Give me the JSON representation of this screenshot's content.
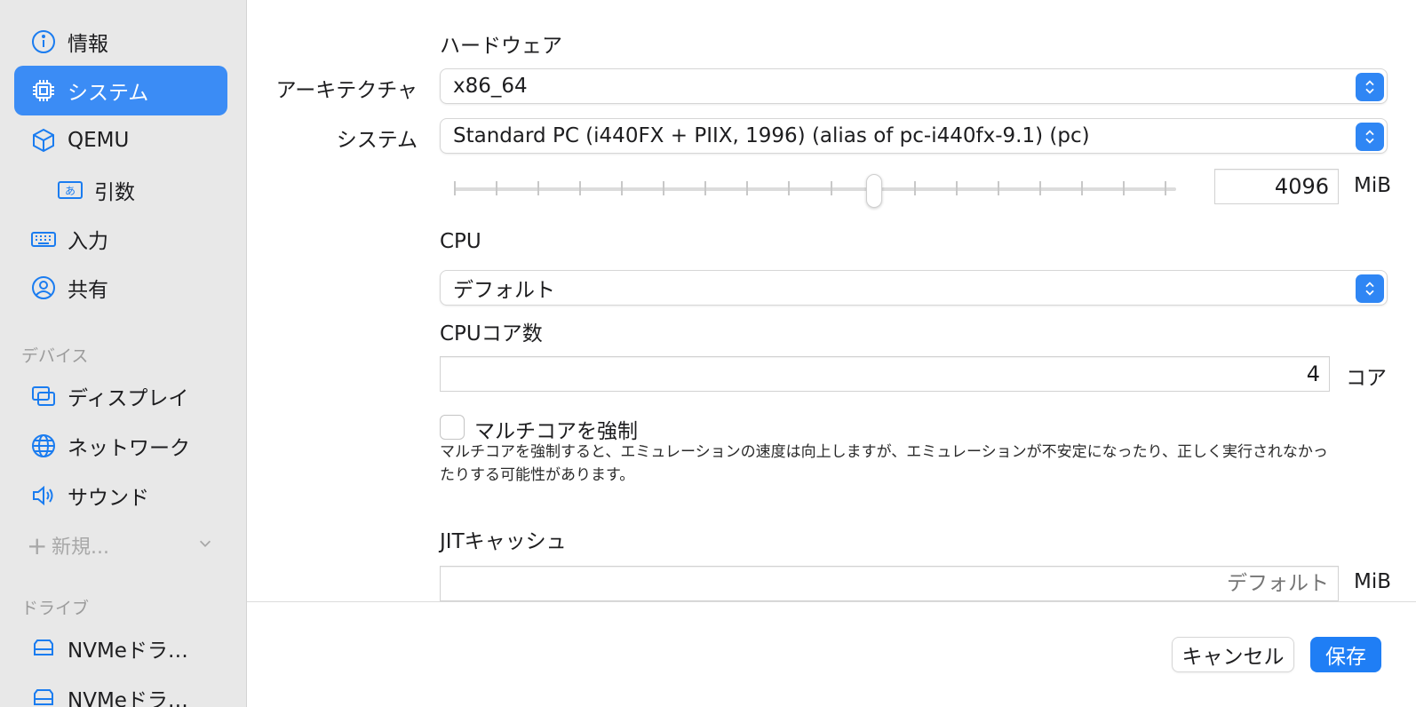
{
  "sidebar": {
    "items": [
      {
        "label": "情報",
        "icon": "info-icon"
      },
      {
        "label": "システム",
        "icon": "cpu-chip-icon",
        "active": true
      },
      {
        "label": "QEMU",
        "icon": "cube-icon"
      },
      {
        "label": "引数",
        "icon": "text-input-icon"
      },
      {
        "label": "入力",
        "icon": "keyboard-icon"
      },
      {
        "label": "共有",
        "icon": "person-circle-icon"
      }
    ],
    "devices_header": "デバイス",
    "devices": [
      {
        "label": "ディスプレイ",
        "icon": "display-icon"
      },
      {
        "label": "ネットワーク",
        "icon": "globe-icon"
      },
      {
        "label": "サウンド",
        "icon": "speaker-icon"
      }
    ],
    "new_label": "新規...",
    "drives_header": "ドライブ",
    "drives": [
      {
        "label": "NVMeドラ…",
        "icon": "drive-icon"
      },
      {
        "label": "NVMeドラ…",
        "icon": "drive-icon"
      }
    ]
  },
  "hardware": {
    "heading": "ハードウェア",
    "architecture_label": "アーキテクチャ",
    "architecture_value": "x86_64",
    "system_label": "システム",
    "system_value": "Standard PC (i440FX + PIIX, 1996) (alias of pc-i440fx-9.1) (pc)",
    "memory_value": "4096",
    "memory_unit": "MiB",
    "memory_slider_fraction": 0.59
  },
  "cpu": {
    "heading": "CPU",
    "value": "デフォルト",
    "cores_heading": "CPUコア数",
    "cores_value": "4",
    "cores_unit": "コア",
    "force_multicore_label": "マルチコアを強制",
    "force_multicore_checked": false,
    "force_multicore_description": "マルチコアを強制すると、エミュレーションの速度は向上しますが、エミュレーションが不安定になったり、正しく実行されなかったりする可能性があります。"
  },
  "jit": {
    "heading": "JITキャッシュ",
    "placeholder": "デフォルト",
    "unit": "MiB"
  },
  "footer": {
    "cancel_label": "キャンセル",
    "save_label": "保存"
  },
  "colors": {
    "accent": "#1f7ef5",
    "sidebar_active": "#3b8cf5",
    "sidebar_bg": "#e8e8e8"
  }
}
